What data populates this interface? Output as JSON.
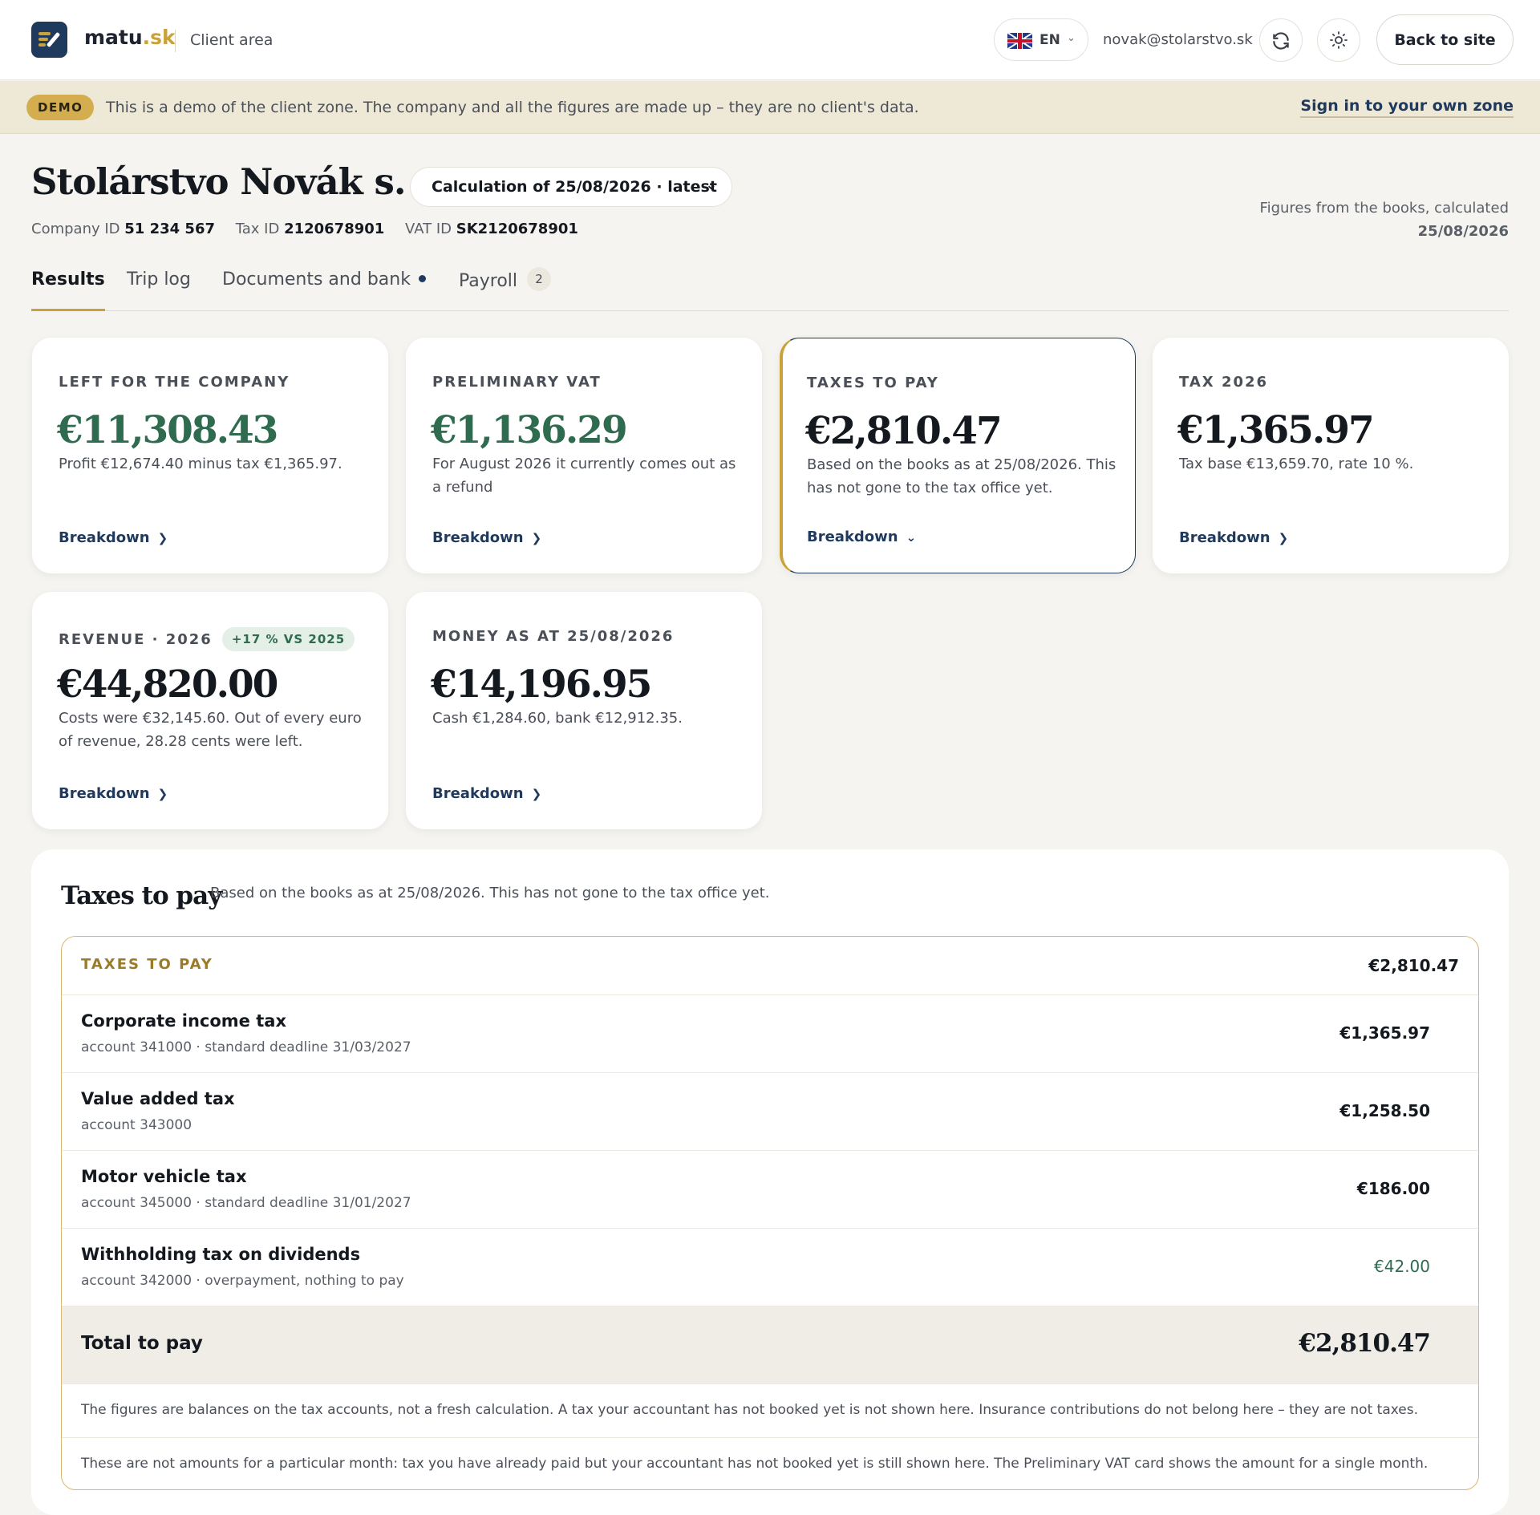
{
  "header": {
    "brand_main": "matu",
    "brand_tld": ".sk",
    "brand_sub": "Client area",
    "lang_code": "EN",
    "email": "novak@stolarstvo.sk",
    "back_label": "Back to site",
    "icons": [
      "logo-icon",
      "uk-flag-icon",
      "chevron-down-icon",
      "refresh-icon",
      "sun-icon"
    ]
  },
  "demo": {
    "badge": "DEMO",
    "text": "This is a demo of the client zone. The company and all the figures are made up – they are no client's data.",
    "link": "Sign in to your own zone"
  },
  "company": {
    "name": "Stolárstvo Novák s. r. o.",
    "calc_select": "Calculation of 25/08/2026 · latest",
    "ids": [
      {
        "label": "Company ID",
        "value": "51 234 567"
      },
      {
        "label": "Tax ID",
        "value": "2120678901"
      },
      {
        "label": "VAT ID",
        "value": "SK2120678901"
      }
    ],
    "note_line1": "Figures from the books, calculated",
    "note_date": "25/08/2026"
  },
  "tabs": [
    {
      "label": "Results",
      "active": true
    },
    {
      "label": "Trip log"
    },
    {
      "label": "Documents and bank",
      "dot": true
    },
    {
      "label": "Payroll",
      "count": "2"
    }
  ],
  "cards": [
    {
      "label": "LEFT FOR THE COMPANY",
      "value": "€11,308.43",
      "green": true,
      "desc": "Profit €12,674.40 minus tax €1,365.97.",
      "link": "Breakdown"
    },
    {
      "label": "PRELIMINARY VAT",
      "value": "€1,136.29",
      "green": true,
      "desc": "For August 2026 it currently comes out as a refund",
      "link": "Breakdown"
    },
    {
      "label": "TAXES TO PAY",
      "value": "€2,810.47",
      "desc": "Based on the books as at 25/08/2026. This has not gone to the tax office yet.",
      "link": "Breakdown",
      "active": true
    },
    {
      "label": "TAX 2026",
      "value": "€1,365.97",
      "desc": "Tax base €13,659.70, rate 10 %.",
      "link": "Breakdown"
    },
    {
      "label": "REVENUE · 2026",
      "badge": "+17 % VS 2025",
      "value": "€44,820.00",
      "desc": "Costs were €32,145.60. Out of every euro of revenue, 28.28 cents were left.",
      "link": "Breakdown"
    },
    {
      "label": "MONEY AS AT 25/08/2026",
      "value": "€14,196.95",
      "desc": "Cash €1,284.60, bank €12,912.35.",
      "link": "Breakdown"
    }
  ],
  "taxes": {
    "title": "Taxes to pay",
    "subtitle": "Based on the books as at 25/08/2026. This has not gone to the tax office yet.",
    "head_label": "TAXES TO PAY",
    "head_amount": "€2,810.47",
    "rows": [
      {
        "name": "Corporate income tax",
        "meta": "account 341000 · standard deadline 31/03/2027",
        "amount": "€1,365.97"
      },
      {
        "name": "Value added tax",
        "meta": "account 343000",
        "amount": "€1,258.50"
      },
      {
        "name": "Motor vehicle tax",
        "meta": "account 345000 · standard deadline 31/01/2027",
        "amount": "€186.00"
      },
      {
        "name": "Withholding tax on dividends",
        "meta": "account 342000 · overpayment, nothing to pay",
        "amount": "€42.00",
        "green": true
      }
    ],
    "total_label": "Total to pay",
    "total_amount": "€2,810.47",
    "note1": "The figures are balances on the tax accounts, not a fresh calculation. A tax your accountant has not booked yet is not shown here. Insurance contributions do not belong here – they are not taxes.",
    "note2": "These are not amounts for a particular month: tax you have already paid but your accountant has not booked yet is still shown here. The Preliminary VAT card shows the amount for a single month."
  },
  "colors": {
    "accent": "#c9a23a",
    "navy": "#1f3a5c",
    "green": "#2e6b4f",
    "banner": "#eee8d7"
  }
}
